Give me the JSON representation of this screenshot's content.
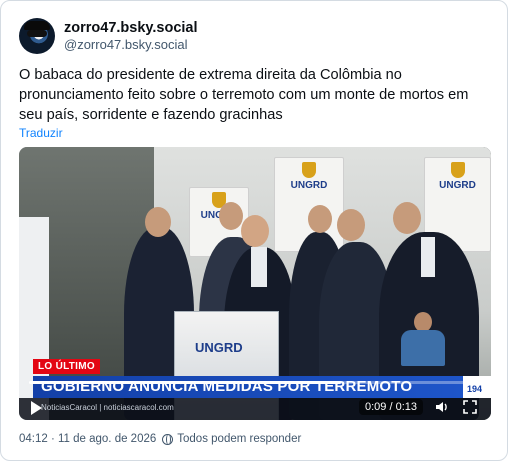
{
  "author": {
    "display_name": "zorro47.bsky.social",
    "handle": "@zorro47.bsky.social"
  },
  "post": {
    "text": "O babaca do presidente de extrema direita da Colômbia no pronunciamento feito sobre o terremoto com um monte de mortos  em seu país, sorridente e fazendo gracinhas",
    "translate_label": "Traduzir"
  },
  "video": {
    "banner_text": "UNGRD",
    "podium_text": "UNGRD",
    "lower_third_tag": "LO ÚLTIMO",
    "headline": "GOBIERNO ANUNCIA MEDIDAS POR TERREMOTO",
    "channel_strip": "NoticiasCaracol  |  noticiascaracol.com",
    "counter": "194",
    "time_display": "0:09 / 0:13",
    "progress_fraction": 0.69,
    "icons": [
      "play-icon",
      "volume-icon",
      "fullscreen-icon"
    ]
  },
  "meta": {
    "timestamp": "04:12 · 11 de ago. de 2026",
    "reply_setting": "Todos podem responder"
  },
  "colors": {
    "link": "#1083fe",
    "ticker_blue": "#1e55c9",
    "tag_red": "#e30613",
    "muted": "#42576c"
  }
}
